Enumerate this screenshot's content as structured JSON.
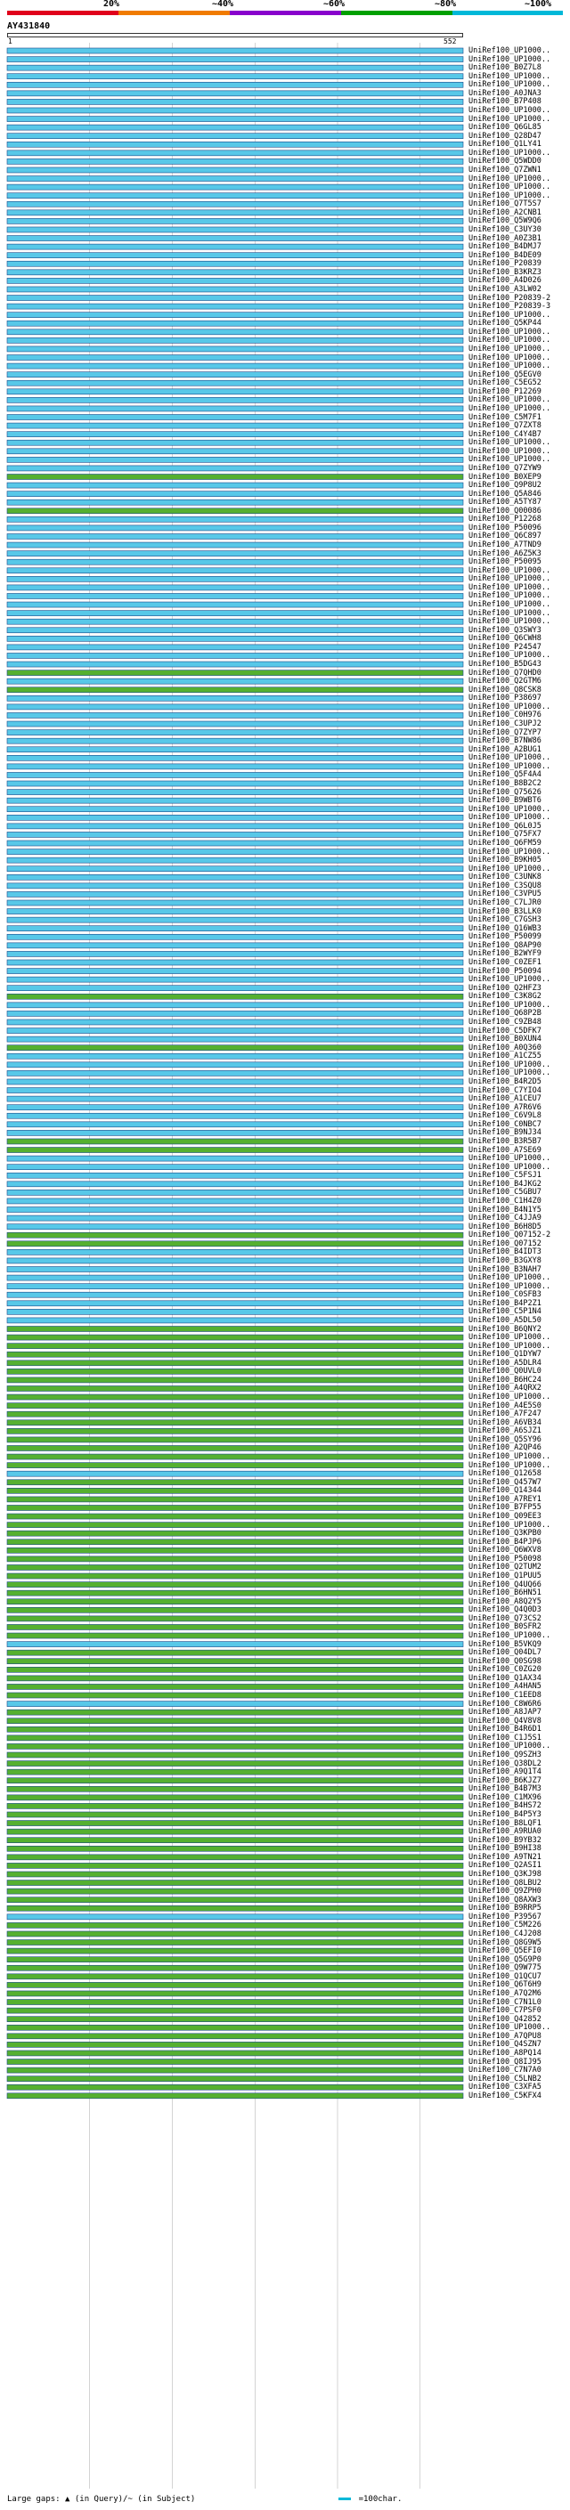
{
  "legend": {
    "ticks": [
      "20%",
      "~40%",
      "~60%",
      "~80%",
      "~100%"
    ],
    "colors": [
      "#e0001b",
      "#f07b00",
      "#8800cc",
      "#00a000",
      "#00b8d8"
    ]
  },
  "query": {
    "id": "AY431840",
    "start": "1",
    "end": "552"
  },
  "colors": {
    "high": "#58c8e8",
    "mid": "#55b030",
    "stroke": "#1a4a8a"
  },
  "hits": [
    {
      "label": "UniRef100_UP1000..",
      "c": "high"
    },
    {
      "label": "UniRef100_UP1000..",
      "c": "high"
    },
    {
      "label": "UniRef100_B0Z7L8",
      "c": "high"
    },
    {
      "label": "UniRef100_UP1000..",
      "c": "high"
    },
    {
      "label": "UniRef100_UP1000..",
      "c": "high"
    },
    {
      "label": "UniRef100_A0JNA3",
      "c": "high"
    },
    {
      "label": "UniRef100_B7P408",
      "c": "high"
    },
    {
      "label": "UniRef100_UP1000..",
      "c": "high"
    },
    {
      "label": "UniRef100_UP1000..",
      "c": "high"
    },
    {
      "label": "UniRef100_Q6GL85",
      "c": "high"
    },
    {
      "label": "UniRef100_Q28D47",
      "c": "high"
    },
    {
      "label": "UniRef100_Q1LY41",
      "c": "high"
    },
    {
      "label": "UniRef100_UP1000..",
      "c": "high"
    },
    {
      "label": "UniRef100_Q5WDD0",
      "c": "high"
    },
    {
      "label": "UniRef100_Q7ZWN1",
      "c": "high"
    },
    {
      "label": "UniRef100_UP1000..",
      "c": "high"
    },
    {
      "label": "UniRef100_UP1000..",
      "c": "high"
    },
    {
      "label": "UniRef100_UP1000..",
      "c": "high"
    },
    {
      "label": "UniRef100_Q7T5S7",
      "c": "high"
    },
    {
      "label": "UniRef100_A2CNB1",
      "c": "high"
    },
    {
      "label": "UniRef100_Q5W9Q6",
      "c": "high"
    },
    {
      "label": "UniRef100_C3UY30",
      "c": "high"
    },
    {
      "label": "UniRef100_A0Z3B1",
      "c": "high"
    },
    {
      "label": "UniRef100_B4DMJ7",
      "c": "high"
    },
    {
      "label": "UniRef100_B4DE09",
      "c": "high"
    },
    {
      "label": "UniRef100_P20839",
      "c": "high"
    },
    {
      "label": "UniRef100_B3KRZ3",
      "c": "high"
    },
    {
      "label": "UniRef100_A4D026",
      "c": "high"
    },
    {
      "label": "UniRef100_A3LW02",
      "c": "high"
    },
    {
      "label": "UniRef100_P20839-2",
      "c": "high"
    },
    {
      "label": "UniRef100_P20839-3",
      "c": "high"
    },
    {
      "label": "UniRef100_UP1000..",
      "c": "high"
    },
    {
      "label": "UniRef100_Q5KP44",
      "c": "high"
    },
    {
      "label": "UniRef100_UP1000..",
      "c": "high"
    },
    {
      "label": "UniRef100_UP1000..",
      "c": "high"
    },
    {
      "label": "UniRef100_UP1000..",
      "c": "high"
    },
    {
      "label": "UniRef100_UP1000..",
      "c": "high"
    },
    {
      "label": "UniRef100_UP1000..",
      "c": "high"
    },
    {
      "label": "UniRef100_Q5EGV0",
      "c": "high"
    },
    {
      "label": "UniRef100_C5EG52",
      "c": "high"
    },
    {
      "label": "UniRef100_P12269",
      "c": "high"
    },
    {
      "label": "UniRef100_UP1000..",
      "c": "high"
    },
    {
      "label": "UniRef100_UP1000..",
      "c": "high"
    },
    {
      "label": "UniRef100_C5M7F1",
      "c": "high"
    },
    {
      "label": "UniRef100_Q7ZXT8",
      "c": "high"
    },
    {
      "label": "UniRef100_C4Y4B7",
      "c": "high"
    },
    {
      "label": "UniRef100_UP1000..",
      "c": "high"
    },
    {
      "label": "UniRef100_UP1000..",
      "c": "high"
    },
    {
      "label": "UniRef100_UP1000..",
      "c": "high"
    },
    {
      "label": "UniRef100_Q7ZYW9",
      "c": "high"
    },
    {
      "label": "UniRef100_B0XEP9",
      "c": "mid"
    },
    {
      "label": "UniRef100_Q9P8U2",
      "c": "high"
    },
    {
      "label": "UniRef100_Q5A846",
      "c": "high"
    },
    {
      "label": "UniRef100_A5TY87",
      "c": "high"
    },
    {
      "label": "UniRef100_Q00086",
      "c": "mid"
    },
    {
      "label": "UniRef100_P12268",
      "c": "high"
    },
    {
      "label": "UniRef100_P50096",
      "c": "high"
    },
    {
      "label": "UniRef100_Q6C897",
      "c": "high"
    },
    {
      "label": "UniRef100_A7TND9",
      "c": "high"
    },
    {
      "label": "UniRef100_A6Z5K3",
      "c": "high"
    },
    {
      "label": "UniRef100_P50095",
      "c": "high"
    },
    {
      "label": "UniRef100_UP1000..",
      "c": "high"
    },
    {
      "label": "UniRef100_UP1000..",
      "c": "high"
    },
    {
      "label": "UniRef100_UP1000..",
      "c": "high"
    },
    {
      "label": "UniRef100_UP1000..",
      "c": "high"
    },
    {
      "label": "UniRef100_UP1000..",
      "c": "high"
    },
    {
      "label": "UniRef100_UP1000..",
      "c": "high"
    },
    {
      "label": "UniRef100_UP1000..",
      "c": "high"
    },
    {
      "label": "UniRef100_Q3SWY3",
      "c": "high"
    },
    {
      "label": "UniRef100_Q6CWH8",
      "c": "high"
    },
    {
      "label": "UniRef100_P24547",
      "c": "high"
    },
    {
      "label": "UniRef100_UP1000..",
      "c": "high"
    },
    {
      "label": "UniRef100_B5DG43",
      "c": "high"
    },
    {
      "label": "UniRef100_Q7QHD0",
      "c": "mid"
    },
    {
      "label": "UniRef100_Q2GTM6",
      "c": "high"
    },
    {
      "label": "UniRef100_Q8CSK8",
      "c": "mid"
    },
    {
      "label": "UniRef100_P38697",
      "c": "high"
    },
    {
      "label": "UniRef100_UP1000..",
      "c": "high"
    },
    {
      "label": "UniRef100_C0H976",
      "c": "high"
    },
    {
      "label": "UniRef100_C3UPJ2",
      "c": "high"
    },
    {
      "label": "UniRef100_Q7ZYP7",
      "c": "high"
    },
    {
      "label": "UniRef100_B7NW86",
      "c": "high"
    },
    {
      "label": "UniRef100_A2BUG1",
      "c": "high"
    },
    {
      "label": "UniRef100_UP1000..",
      "c": "high"
    },
    {
      "label": "UniRef100_UP1000..",
      "c": "high"
    },
    {
      "label": "UniRef100_Q5F4A4",
      "c": "high"
    },
    {
      "label": "UniRef100_B8B2C2",
      "c": "high"
    },
    {
      "label": "UniRef100_Q75626",
      "c": "high"
    },
    {
      "label": "UniRef100_B9WBT6",
      "c": "high"
    },
    {
      "label": "UniRef100_UP1000..",
      "c": "high"
    },
    {
      "label": "UniRef100_UP1000..",
      "c": "high"
    },
    {
      "label": "UniRef100_Q6L0J5",
      "c": "high"
    },
    {
      "label": "UniRef100_Q75FX7",
      "c": "high"
    },
    {
      "label": "UniRef100_Q6FM59",
      "c": "high"
    },
    {
      "label": "UniRef100_UP1000..",
      "c": "high"
    },
    {
      "label": "UniRef100_B9KH05",
      "c": "high"
    },
    {
      "label": "UniRef100_UP1000..",
      "c": "high"
    },
    {
      "label": "UniRef100_C3UNK8",
      "c": "high"
    },
    {
      "label": "UniRef100_C3SQU8",
      "c": "high"
    },
    {
      "label": "UniRef100_C3VPU5",
      "c": "high"
    },
    {
      "label": "UniRef100_C7LJR0",
      "c": "high"
    },
    {
      "label": "UniRef100_B3LLK0",
      "c": "high"
    },
    {
      "label": "UniRef100_C7GSH3",
      "c": "high"
    },
    {
      "label": "UniRef100_Q16WB3",
      "c": "high"
    },
    {
      "label": "UniRef100_P50099",
      "c": "high"
    },
    {
      "label": "UniRef100_Q8AP90",
      "c": "high"
    },
    {
      "label": "UniRef100_B2WYF9",
      "c": "high"
    },
    {
      "label": "UniRef100_C0ZEF1",
      "c": "high"
    },
    {
      "label": "UniRef100_P50094",
      "c": "high"
    },
    {
      "label": "UniRef100_UP1000..",
      "c": "high"
    },
    {
      "label": "UniRef100_Q2HFZ3",
      "c": "high"
    },
    {
      "label": "UniRef100_C3K8G2",
      "c": "mid"
    },
    {
      "label": "UniRef100_UP1000..",
      "c": "high"
    },
    {
      "label": "UniRef100_Q68P2B",
      "c": "high"
    },
    {
      "label": "UniRef100_C9ZB48",
      "c": "high"
    },
    {
      "label": "UniRef100_C5DFK7",
      "c": "high"
    },
    {
      "label": "UniRef100_B0XUN4",
      "c": "high"
    },
    {
      "label": "UniRef100_A0Q360",
      "c": "mid"
    },
    {
      "label": "UniRef100_A1CZ55",
      "c": "high"
    },
    {
      "label": "UniRef100_UP1000..",
      "c": "high"
    },
    {
      "label": "UniRef100_UP1000..",
      "c": "high"
    },
    {
      "label": "UniRef100_B4R2D5",
      "c": "high"
    },
    {
      "label": "UniRef100_C7YIO4",
      "c": "high"
    },
    {
      "label": "UniRef100_A1CEU7",
      "c": "high"
    },
    {
      "label": "UniRef100_A7R6V6",
      "c": "high"
    },
    {
      "label": "UniRef100_C6V9L8",
      "c": "high"
    },
    {
      "label": "UniRef100_C0NBC7",
      "c": "high"
    },
    {
      "label": "UniRef100_B9NJ34",
      "c": "high"
    },
    {
      "label": "UniRef100_B3R5B7",
      "c": "mid"
    },
    {
      "label": "UniRef100_A7SE69",
      "c": "mid"
    },
    {
      "label": "UniRef100_UP1000..",
      "c": "high"
    },
    {
      "label": "UniRef100_UP1000..",
      "c": "high"
    },
    {
      "label": "UniRef100_C5FSJ1",
      "c": "high"
    },
    {
      "label": "UniRef100_B4JKG2",
      "c": "high"
    },
    {
      "label": "UniRef100_C5GBU7",
      "c": "high"
    },
    {
      "label": "UniRef100_C1H4Z0",
      "c": "high"
    },
    {
      "label": "UniRef100_B4N1Y5",
      "c": "high"
    },
    {
      "label": "UniRef100_C4JJA9",
      "c": "high"
    },
    {
      "label": "UniRef100_B6H8D5",
      "c": "high"
    },
    {
      "label": "UniRef100_Q07152-2",
      "c": "mid"
    },
    {
      "label": "UniRef100_Q07152",
      "c": "mid"
    },
    {
      "label": "UniRef100_B4IDT3",
      "c": "high"
    },
    {
      "label": "UniRef100_B3GXY8",
      "c": "high"
    },
    {
      "label": "UniRef100_B3NAH7",
      "c": "high"
    },
    {
      "label": "UniRef100_UP1000..",
      "c": "high"
    },
    {
      "label": "UniRef100_UP1000..",
      "c": "high"
    },
    {
      "label": "UniRef100_C0SFB3",
      "c": "high"
    },
    {
      "label": "UniRef100_B4P2Z1",
      "c": "high"
    },
    {
      "label": "UniRef100_C5P1N4",
      "c": "high"
    },
    {
      "label": "UniRef100_A5DL50",
      "c": "high"
    },
    {
      "label": "UniRef100_B6QNY2",
      "c": "mid"
    },
    {
      "label": "UniRef100_UP1000..",
      "c": "mid"
    },
    {
      "label": "UniRef100_UP1000..",
      "c": "mid"
    },
    {
      "label": "UniRef100_Q1DYW7",
      "c": "mid"
    },
    {
      "label": "UniRef100_A5DLR4",
      "c": "mid"
    },
    {
      "label": "UniRef100_Q0UVL0",
      "c": "mid"
    },
    {
      "label": "UniRef100_B6HC24",
      "c": "mid"
    },
    {
      "label": "UniRef100_A4QRX2",
      "c": "mid"
    },
    {
      "label": "UniRef100_UP1000..",
      "c": "mid"
    },
    {
      "label": "UniRef100_A4E5S0",
      "c": "mid"
    },
    {
      "label": "UniRef100_A7F247",
      "c": "mid"
    },
    {
      "label": "UniRef100_A6VB34",
      "c": "mid"
    },
    {
      "label": "UniRef100_A6SJZ1",
      "c": "mid"
    },
    {
      "label": "UniRef100_Q5SY96",
      "c": "mid"
    },
    {
      "label": "UniRef100_A2QP46",
      "c": "mid"
    },
    {
      "label": "UniRef100_UP1000..",
      "c": "mid"
    },
    {
      "label": "UniRef100_UP1000..",
      "c": "mid"
    },
    {
      "label": "UniRef100_Q12658",
      "c": "high"
    },
    {
      "label": "UniRef100_Q457W7",
      "c": "mid"
    },
    {
      "label": "UniRef100_Q14344",
      "c": "mid"
    },
    {
      "label": "UniRef100_A7REY1",
      "c": "mid"
    },
    {
      "label": "UniRef100_B7FP55",
      "c": "mid"
    },
    {
      "label": "UniRef100_Q09EE3",
      "c": "mid"
    },
    {
      "label": "UniRef100_UP1000..",
      "c": "mid"
    },
    {
      "label": "UniRef100_Q3KPB0",
      "c": "mid"
    },
    {
      "label": "UniRef100_B4PJP6",
      "c": "mid"
    },
    {
      "label": "UniRef100_Q6WXV8",
      "c": "mid"
    },
    {
      "label": "UniRef100_P50098",
      "c": "mid"
    },
    {
      "label": "UniRef100_Q2TUM2",
      "c": "mid"
    },
    {
      "label": "UniRef100_Q1PUU5",
      "c": "mid"
    },
    {
      "label": "UniRef100_Q4UQ66",
      "c": "mid"
    },
    {
      "label": "UniRef100_B6HN51",
      "c": "mid"
    },
    {
      "label": "UniRef100_A8Q2Y5",
      "c": "mid"
    },
    {
      "label": "UniRef100_Q4Q0D3",
      "c": "mid"
    },
    {
      "label": "UniRef100_Q73CS2",
      "c": "mid"
    },
    {
      "label": "UniRef100_B0SFR2",
      "c": "mid"
    },
    {
      "label": "UniRef100_UP1000..",
      "c": "mid"
    },
    {
      "label": "UniRef100_B5VKQ9",
      "c": "high"
    },
    {
      "label": "UniRef100_Q04DL7",
      "c": "mid"
    },
    {
      "label": "UniRef100_Q0SG98",
      "c": "mid"
    },
    {
      "label": "UniRef100_C0ZG20",
      "c": "mid"
    },
    {
      "label": "UniRef100_Q1AX34",
      "c": "mid"
    },
    {
      "label": "UniRef100_A4HAN5",
      "c": "mid"
    },
    {
      "label": "UniRef100_C1EED8",
      "c": "mid"
    },
    {
      "label": "UniRef100_C8W6R6",
      "c": "high"
    },
    {
      "label": "UniRef100_A8JAP7",
      "c": "mid"
    },
    {
      "label": "UniRef100_Q4V8V8",
      "c": "mid"
    },
    {
      "label": "UniRef100_B4R6D1",
      "c": "mid"
    },
    {
      "label": "UniRef100_C1J5S1",
      "c": "mid"
    },
    {
      "label": "UniRef100_UP1000..",
      "c": "mid"
    },
    {
      "label": "UniRef100_Q9SZH3",
      "c": "mid"
    },
    {
      "label": "UniRef100_Q38DL2",
      "c": "mid"
    },
    {
      "label": "UniRef100_A9Q1T4",
      "c": "mid"
    },
    {
      "label": "UniRef100_B6KJZ7",
      "c": "mid"
    },
    {
      "label": "UniRef100_B4B7M3",
      "c": "mid"
    },
    {
      "label": "UniRef100_C1MX96",
      "c": "mid"
    },
    {
      "label": "UniRef100_B4HS72",
      "c": "mid"
    },
    {
      "label": "UniRef100_B4P5Y3",
      "c": "mid"
    },
    {
      "label": "UniRef100_B8LQF1",
      "c": "mid"
    },
    {
      "label": "UniRef100_A9RUA0",
      "c": "mid"
    },
    {
      "label": "UniRef100_B9YB32",
      "c": "mid"
    },
    {
      "label": "UniRef100_B9HI38",
      "c": "mid"
    },
    {
      "label": "UniRef100_A9TN21",
      "c": "mid"
    },
    {
      "label": "UniRef100_Q2ASI1",
      "c": "mid"
    },
    {
      "label": "UniRef100_Q3KJ98",
      "c": "mid"
    },
    {
      "label": "UniRef100_Q8LBU2",
      "c": "mid"
    },
    {
      "label": "UniRef100_Q9ZPH0",
      "c": "mid"
    },
    {
      "label": "UniRef100_Q8AXW3",
      "c": "mid"
    },
    {
      "label": "UniRef100_B9RRP5",
      "c": "mid"
    },
    {
      "label": "UniRef100_P39567",
      "c": "high"
    },
    {
      "label": "UniRef100_C5M226",
      "c": "mid"
    },
    {
      "label": "UniRef100_C4J208",
      "c": "mid"
    },
    {
      "label": "UniRef100_Q8G9W5",
      "c": "mid"
    },
    {
      "label": "UniRef100_Q5EFI0",
      "c": "mid"
    },
    {
      "label": "UniRef100_Q5G9P0",
      "c": "mid"
    },
    {
      "label": "UniRef100_Q9W775",
      "c": "mid"
    },
    {
      "label": "UniRef100_Q1QCU7",
      "c": "mid"
    },
    {
      "label": "UniRef100_Q6T6H9",
      "c": "mid"
    },
    {
      "label": "UniRef100_A7Q2M6",
      "c": "mid"
    },
    {
      "label": "UniRef100_C7N1L0",
      "c": "mid"
    },
    {
      "label": "UniRef100_C7PSF0",
      "c": "mid"
    },
    {
      "label": "UniRef100_Q42852",
      "c": "mid"
    },
    {
      "label": "UniRef100_UP1000..",
      "c": "mid"
    },
    {
      "label": "UniRef100_A7QPU8",
      "c": "mid"
    },
    {
      "label": "UniRef100_Q4SZN7",
      "c": "mid"
    },
    {
      "label": "UniRef100_A8PQ14",
      "c": "mid"
    },
    {
      "label": "UniRef100_Q8IJ95",
      "c": "mid"
    },
    {
      "label": "UniRef100_C7N7A0",
      "c": "mid"
    },
    {
      "label": "UniRef100_C5LNB2",
      "c": "mid"
    },
    {
      "label": "UniRef100_C3XFA5",
      "c": "mid"
    },
    {
      "label": "UniRef100_C5KFX4",
      "c": "mid"
    }
  ],
  "footer": {
    "text": "Large gaps: ▲ (in Query)/~ (in Subject)",
    "scale": "=100char."
  }
}
